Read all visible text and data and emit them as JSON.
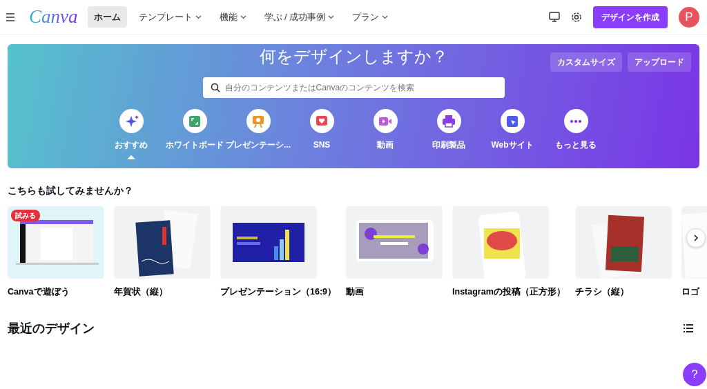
{
  "nav": {
    "logo": "Canva",
    "items": [
      {
        "label": "ホーム",
        "selected": true,
        "dropdown": false
      },
      {
        "label": "テンプレート",
        "selected": false,
        "dropdown": true
      },
      {
        "label": "機能",
        "selected": false,
        "dropdown": true
      },
      {
        "label": "学ぶ / 成功事例",
        "selected": false,
        "dropdown": true
      },
      {
        "label": "プラン",
        "selected": false,
        "dropdown": true
      }
    ],
    "create_button": "デザインを作成",
    "avatar": "P"
  },
  "hero": {
    "title": "何をデザインしますか？",
    "buttons": [
      "カスタムサイズ",
      "アップロード"
    ],
    "search": {
      "placeholder": "自分のコンテンツまたはCanvaのコンテンツを検索"
    },
    "categories": [
      {
        "label": "おすすめ",
        "selected": true,
        "kind": "sparkle",
        "color": "#5b4fe0"
      },
      {
        "label": "ホワイトボード",
        "selected": false,
        "kind": "board",
        "color": "#3fa36b"
      },
      {
        "label": "プレゼンテーシ...",
        "selected": false,
        "kind": "present",
        "color": "#f0932b"
      },
      {
        "label": "SNS",
        "selected": false,
        "kind": "heart",
        "color": "#e8474f"
      },
      {
        "label": "動画",
        "selected": false,
        "kind": "video",
        "color": "#c05ad8"
      },
      {
        "label": "印刷製品",
        "selected": false,
        "kind": "print",
        "color": "#8b3ee6"
      },
      {
        "label": "Webサイト",
        "selected": false,
        "kind": "web",
        "color": "#4a5be8"
      },
      {
        "label": "もっと見る",
        "selected": false,
        "kind": "more",
        "color": "#7d2ae8"
      }
    ]
  },
  "suggest": {
    "title": "こちらも試してみませんか？",
    "cards": [
      {
        "label": "Canvaで遊ぼう",
        "badge": "試みる",
        "kind": "laptop"
      },
      {
        "label": "年賀状（縦）",
        "kind": "card"
      },
      {
        "label": "プレゼンテーション（16:9）",
        "kind": "slide"
      },
      {
        "label": "動画",
        "kind": "video"
      },
      {
        "label": "Instagramの投稿（正方形）",
        "kind": "phone"
      },
      {
        "label": "チラシ（縦）",
        "kind": "flyer"
      },
      {
        "label": "ロゴ",
        "kind": "logo"
      }
    ]
  },
  "recent": {
    "title": "最近のデザイン"
  },
  "help": "?"
}
